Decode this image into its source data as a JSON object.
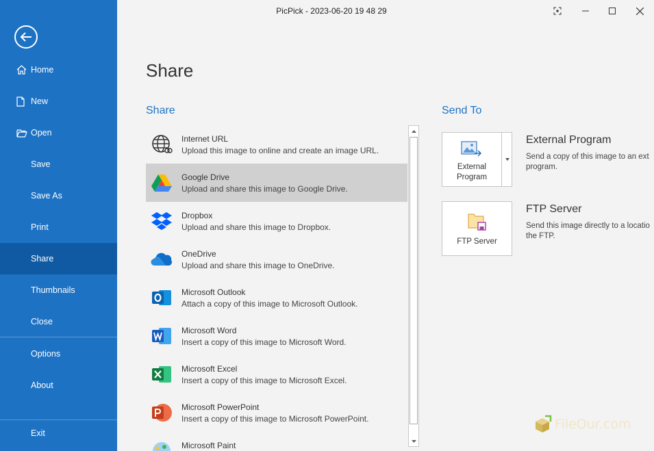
{
  "window": {
    "title": "PicPick - 2023-06-20 19 48 29"
  },
  "sidebar": {
    "items": [
      {
        "label": "Home"
      },
      {
        "label": "New"
      },
      {
        "label": "Open"
      },
      {
        "label": "Save"
      },
      {
        "label": "Save As"
      },
      {
        "label": "Print"
      },
      {
        "label": "Share"
      },
      {
        "label": "Thumbnails"
      },
      {
        "label": "Close"
      },
      {
        "label": "Options"
      },
      {
        "label": "About"
      },
      {
        "label": "Exit"
      }
    ]
  },
  "main": {
    "title": "Share",
    "share_heading": "Share",
    "send_heading": "Send To"
  },
  "share_items": [
    {
      "name": "Internet URL",
      "desc": "Upload this image to online and create an image URL.",
      "icon": "globe-icon"
    },
    {
      "name": "Google Drive",
      "desc": "Upload and share this image to Google Drive.",
      "icon": "google-drive-icon"
    },
    {
      "name": "Dropbox",
      "desc": "Upload and share this image to Dropbox.",
      "icon": "dropbox-icon"
    },
    {
      "name": "OneDrive",
      "desc": "Upload and share this image to OneDrive.",
      "icon": "onedrive-icon"
    },
    {
      "name": "Microsoft Outlook",
      "desc": "Attach a copy of this image to Microsoft Outlook.",
      "icon": "outlook-icon"
    },
    {
      "name": "Microsoft Word",
      "desc": "Insert a copy of this image to Microsoft Word.",
      "icon": "word-icon"
    },
    {
      "name": "Microsoft Excel",
      "desc": "Insert a copy of this image to Microsoft Excel.",
      "icon": "excel-icon"
    },
    {
      "name": "Microsoft PowerPoint",
      "desc": "Insert a copy of this image to Microsoft PowerPoint.",
      "icon": "powerpoint-icon"
    },
    {
      "name": "Microsoft Paint",
      "desc": "",
      "icon": "paint-icon"
    }
  ],
  "send_to": {
    "external": {
      "button_line1": "External",
      "button_line2": "Program",
      "title": "External Program",
      "desc_line1": "Send a copy of this image to an ext",
      "desc_line2": "program."
    },
    "ftp": {
      "button_label": "FTP Server",
      "title": "FTP Server",
      "desc_line1": "Send this image directly to a locatio",
      "desc_line2": "the FTP."
    }
  },
  "watermark": {
    "text": "FileOur.com"
  },
  "colors": {
    "sidebar": "#1d72c4",
    "sidebar_active": "#0f5aa3",
    "accent": "#1d72c4",
    "selected_row": "#d0d0d0"
  }
}
